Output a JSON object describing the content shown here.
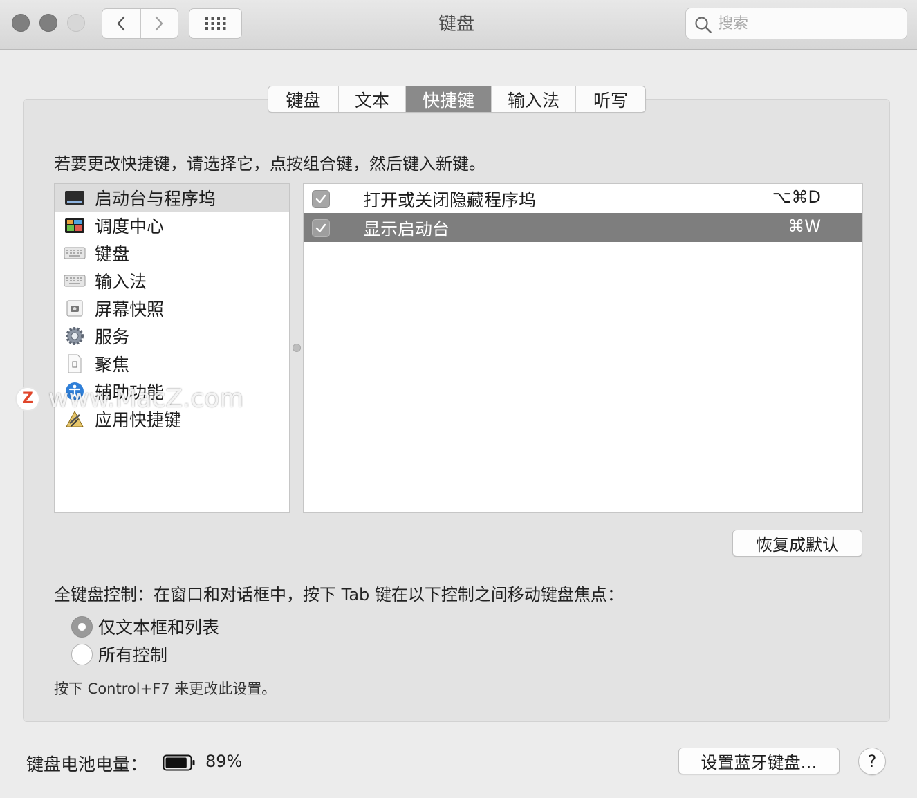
{
  "window": {
    "title": "键盘"
  },
  "toolbar": {
    "back_icon": "chevron-left-icon",
    "forward_icon": "chevron-right-icon",
    "grid_icon": "grid-icon"
  },
  "search": {
    "placeholder": "搜索",
    "value": ""
  },
  "tabs": [
    {
      "label": "键盘",
      "active": false
    },
    {
      "label": "文本",
      "active": false
    },
    {
      "label": "快捷键",
      "active": true
    },
    {
      "label": "输入法",
      "active": false
    },
    {
      "label": "听写",
      "active": false
    }
  ],
  "instruction": "若要更改快捷键，请选择它，点按组合键，然后键入新键。",
  "categories": [
    {
      "label": "启动台与程序坞",
      "icon": "launchpad-dock-icon",
      "selected": true
    },
    {
      "label": "调度中心",
      "icon": "mission-control-icon",
      "selected": false
    },
    {
      "label": "键盘",
      "icon": "keyboard-icon",
      "selected": false
    },
    {
      "label": "输入法",
      "icon": "input-source-icon",
      "selected": false
    },
    {
      "label": "屏幕快照",
      "icon": "screenshot-icon",
      "selected": false
    },
    {
      "label": "服务",
      "icon": "services-gear-icon",
      "selected": false
    },
    {
      "label": "聚焦",
      "icon": "spotlight-icon",
      "selected": false
    },
    {
      "label": "辅助功能",
      "icon": "accessibility-icon",
      "selected": false
    },
    {
      "label": "应用快捷键",
      "icon": "app-shortcuts-icon",
      "selected": false
    }
  ],
  "shortcuts": [
    {
      "label": "打开或关闭隐藏程序坞",
      "keys": "⌥⌘D",
      "checked": true,
      "selected": false
    },
    {
      "label": "显示启动台",
      "keys": "⌘W",
      "checked": true,
      "selected": true
    }
  ],
  "restore_button": "恢复成默认",
  "full_keyboard": {
    "label": "全键盘控制：在窗口和对话框中，按下 Tab 键在以下控制之间移动键盘焦点：",
    "options": [
      {
        "label": "仅文本框和列表",
        "selected": true
      },
      {
        "label": "所有控制",
        "selected": false
      }
    ],
    "hint": "按下 Control+F7 来更改此设置。"
  },
  "footer": {
    "battery_label": "键盘电池电量：",
    "battery_percent": "89%",
    "battery_level": 0.89,
    "bluetooth_button": "设置蓝牙键盘…",
    "help_label": "?"
  },
  "watermark": {
    "logo": "Z",
    "text": "www.MacZ.com"
  },
  "colors": {
    "selected_row": "#7e7e7e",
    "active_tab": "#8a8a8a",
    "window_bg": "#ececec"
  }
}
